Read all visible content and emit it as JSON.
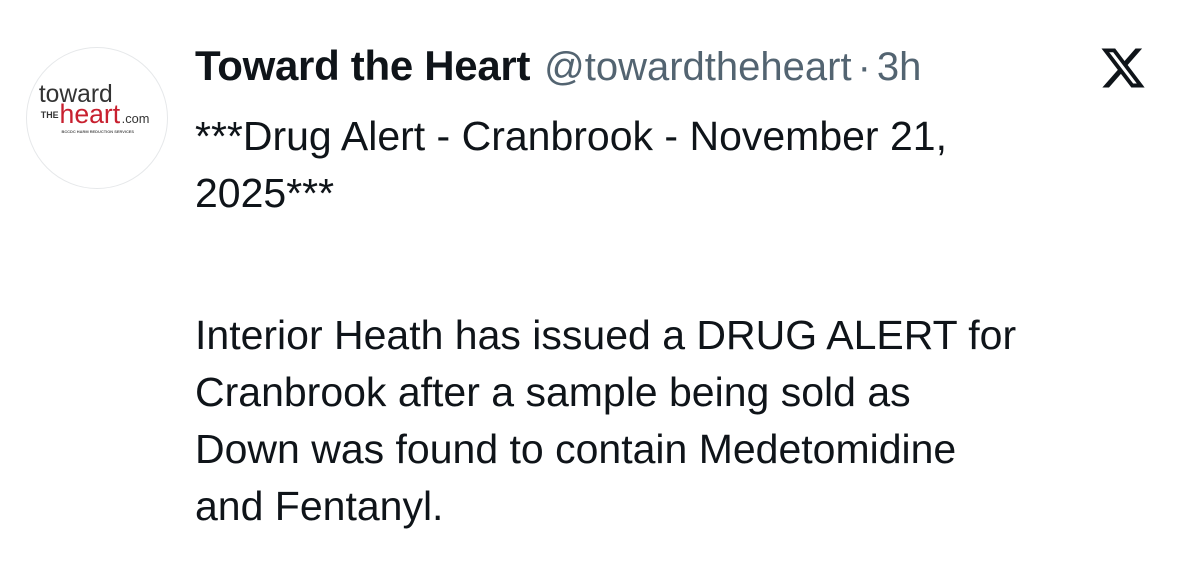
{
  "tweet": {
    "avatar": {
      "logo_top": "toward",
      "logo_the": "THE",
      "logo_main": "heart",
      "logo_suffix": ".com",
      "logo_tagline": "BCCDC HARM REDUCTION SERVICES"
    },
    "display_name": "Toward the Heart",
    "handle": "@towardtheheart",
    "separator": "·",
    "time": "3h",
    "platform_icon": "x-logo-icon",
    "text_para1": "***Drug Alert - Cranbrook - November 21,\n2025***",
    "text_para2": "Interior Heath has issued a DRUG ALERT for\nCranbrook after a sample being sold as\nDown was found to contain Medetomidine\nand Fentanyl.",
    "colors": {
      "text": "#0f1419",
      "secondary": "#536471",
      "logo_red": "#c8202f"
    }
  }
}
